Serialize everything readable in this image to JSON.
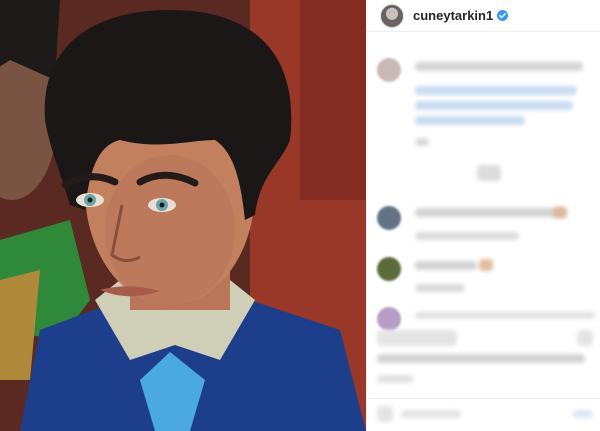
{
  "post": {
    "username": "cuneytarkin1",
    "verified": true,
    "photo_alt": "Portrait photo"
  },
  "colors": {
    "verified_blue": "#3897f0",
    "link_blue": "#c9dbf2",
    "blur_gray": "#d6d6d6"
  },
  "icons": {
    "verified": "verified-badge-icon"
  }
}
